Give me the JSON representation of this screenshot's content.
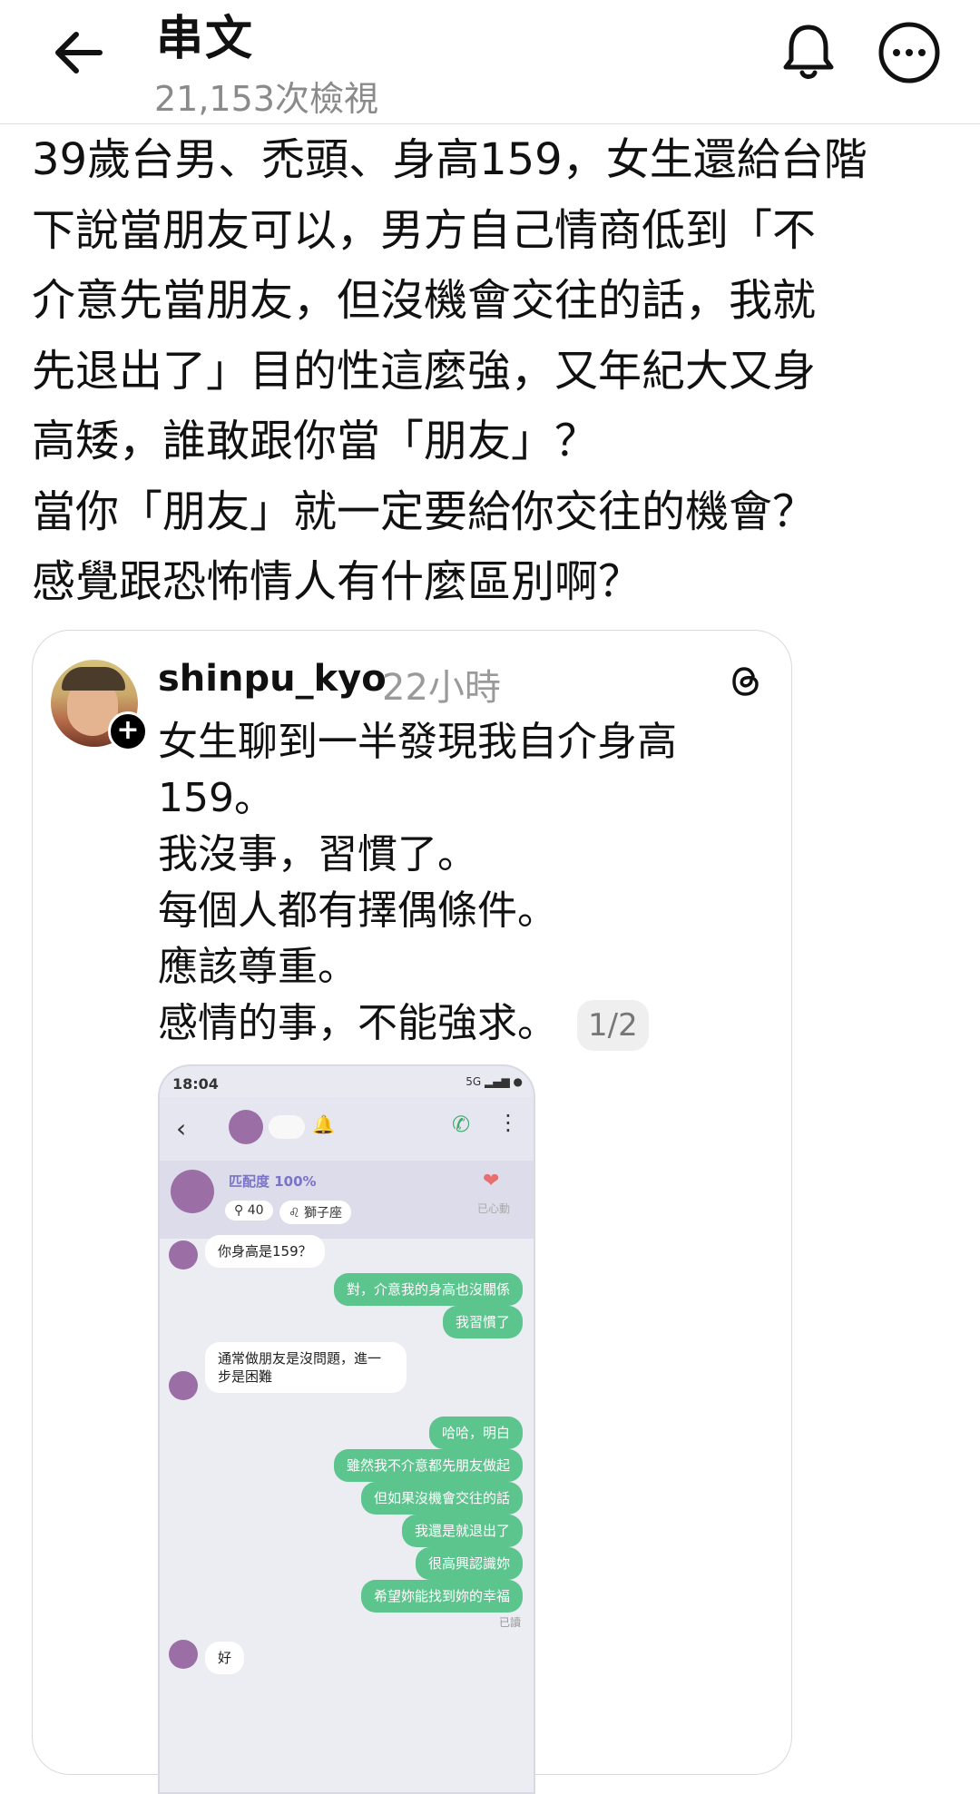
{
  "header": {
    "title": "串文",
    "views": "21,153次檢視",
    "back_icon": "arrow-left-icon",
    "bell_icon": "bell-icon",
    "more_icon": "more-horizontal-icon"
  },
  "post": {
    "lines": [
      "39歲台男、禿頭、身高159，女生還給台階",
      "下說當朋友可以，男方自己情商低到「不",
      "介意先當朋友，但沒機會交往的話，我就",
      "先退出了」目的性這麼強，又年紀大又身",
      "高矮，誰敢跟你當「朋友」？",
      "當你「朋友」就一定要給你交往的機會？",
      "感覺跟恐怖情人有什麼區別啊？"
    ]
  },
  "quoted": {
    "username": "shinpu_kyo",
    "time": "22小時",
    "lines": [
      "女生聊到一半發現我自介身高",
      "159。",
      "我沒事，習慣了。",
      "每個人都有擇偶條件。",
      "應該尊重。",
      "感情的事，不能強求。"
    ],
    "page_badge": "1/2",
    "threads_icon": "threads-logo-icon"
  },
  "screenshot": {
    "time": "18:04",
    "match_label": "匹配度 100%",
    "age_chip": "40",
    "zodiac_chip": "獅子座",
    "liked_label": "已心動",
    "messages": [
      {
        "side": "left",
        "text": "你身高是159？"
      },
      {
        "side": "right",
        "text": "對，介意我的身高也沒關係"
      },
      {
        "side": "right",
        "text": "我習慣了"
      },
      {
        "side": "left",
        "text": "通常做朋友是沒問題，進一步是困"
      },
      {
        "side": "left",
        "text": "難"
      },
      {
        "side": "right",
        "text": "哈哈，明白"
      },
      {
        "side": "right",
        "text": "雖然我不介意都先朋友做起"
      },
      {
        "side": "right",
        "text": "但如果沒機會交往的話"
      },
      {
        "side": "right",
        "text": "我還是就退出了"
      },
      {
        "side": "right",
        "text": "很高興認識妳"
      },
      {
        "side": "right",
        "text": "希望妳能找到妳的幸福"
      },
      {
        "side": "left",
        "text": "好"
      }
    ],
    "read_label": "已讀",
    "colors": {
      "bubble_right": "#5cc48d",
      "bubble_left": "#ffffff"
    }
  }
}
